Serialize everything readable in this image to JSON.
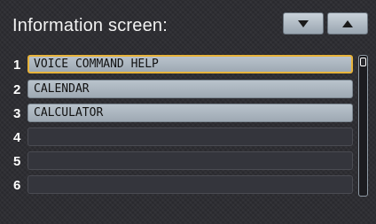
{
  "header": {
    "title": "Information screen:"
  },
  "scroll_buttons": {
    "down_icon": "triangle-down-icon",
    "up_icon": "triangle-up-icon"
  },
  "list": {
    "items": [
      {
        "number": "1",
        "label": "VOICE COMMAND HELP",
        "selected": true
      },
      {
        "number": "2",
        "label": "CALENDAR",
        "selected": false
      },
      {
        "number": "3",
        "label": "CALCULATOR",
        "selected": false
      },
      {
        "number": "4",
        "label": "",
        "selected": false
      },
      {
        "number": "5",
        "label": "",
        "selected": false
      },
      {
        "number": "6",
        "label": "",
        "selected": false
      }
    ]
  },
  "colors": {
    "background": "#2b2b30",
    "item_fill": "#b9c3cc",
    "selection_border": "#e8b43c",
    "empty_item_fill": "#34353c"
  }
}
